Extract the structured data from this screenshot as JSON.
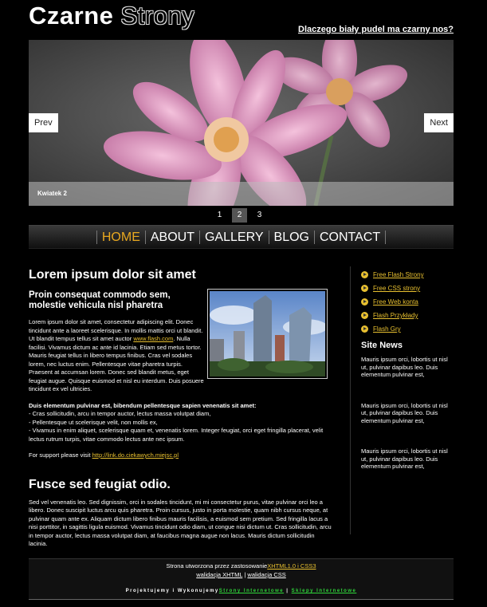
{
  "header": {
    "logo_word1": "Czarne",
    "logo_word2": "Strony",
    "tagline": "Dlaczego biały pudel ma czarny nos?"
  },
  "slider": {
    "prev_label": "Prev",
    "next_label": "Next",
    "caption": "Kwiatek 2",
    "pages": [
      "1",
      "2",
      "3"
    ],
    "active_page": "2"
  },
  "nav": {
    "items": [
      "HOME",
      "ABOUT",
      "GALLERY",
      "BLOG",
      "CONTACT"
    ],
    "active": "HOME",
    "active_color": "#e8a820"
  },
  "main": {
    "title": "Lorem ipsum dolor sit amet",
    "subtitle": "Proin consequat commodo sem, molestie vehicula nisl pharetra",
    "para1_start": "Lorem ipsum dolor sit amet, consectetur adipiscing elit. Donec tincidunt ante a laoreet scelerisque. In mollis mattis orci ut blandit. Ut blandit tempus tellus sit amet auctor ",
    "para1_link": "www.flash.com",
    "para1_end": ". Nulla facilisi. Vivamus dictum ac ante id lacinia. Etiam sed metus tortor. Mauris feugiat tellus in libero tempus finibus. Cras vel sodales lorem, nec luctus enim. Pellentesque vitae pharetra turpis. Praesent at accumsan lorem. Donec sed blandit metus, eget feugiat augue. Quisque euismod et nisl eu interdum. Duis posuere tincidunt ex vel ultricies.",
    "list_title": "Duis elementum pulvinar est, bibendum pellentesque sapien venenatis sit amet:",
    "list_items": [
      "- Cras sollicitudin, arcu in tempor auctor, lectus massa volutpat diam,",
      "- Pellentesque ut scelerisque velit, non mollis ex,",
      "- Vivamus in enim aliquet, scelerisque quam et, venenatis lorem. Integer feugiat, orci eget fringilla placerat, velit lectus rutrum turpis, vitae commodo lectus ante nec ipsum."
    ],
    "support_text": "For support please visit ",
    "support_link": "http://link.do.ciekawych.miejsc.pl",
    "title2": "Fusce sed feugiat odio.",
    "para2": "Sed vel venenatis leo. Sed dignissim, orci in sodales tincidunt, mi mi consectetur purus, vitae pulvinar orci leo a libero. Donec suscipit luctus arcu quis pharetra. Proin cursus, justo in porta molestie, quam nibh cursus neque, at pulvinar quam ante ex. Aliquam dictum libero finibus mauris facilisis, a euismod sem pretium. Sed fringilla lacus a nisi porttitor, in sagittis ligula euismod. Vivamus tincidunt odio diam, ut congue nisi dictum ut. Cras sollicitudin, arcu in tempor auctor, lectus massa volutpat diam, at faucibus magna augue non lacus. Mauris dictum sollicitudin lacinia."
  },
  "sidebar": {
    "links": [
      "Free Flash Strony",
      "Free CSS strony",
      "Free Web konta",
      "Flash Przykłady",
      "Flash Gry"
    ],
    "news_title": "Site News",
    "news": [
      "Mauris ipsum orci, lobortis ut nisl ut, pulvinar dapibus leo. Duis elementum pulvinar est,",
      "Mauris ipsum orci, lobortis ut nisl ut, pulvinar dapibus leo. Duis elementum pulvinar est,",
      "Mauris ipsum orci, lobortis ut nisl ut, pulvinar dapibus leo. Duis elementum pulvinar est,"
    ]
  },
  "footer": {
    "created_text": "Strona utworzona przez zastosowanie",
    "xhtml_css": "XHTML1.0 i CSS3",
    "valid_xhtml": "walidacja XHTML",
    "separator": "|",
    "valid_css": "walidacja CSS",
    "credit_text": "Projektujemy i Wykonujemy",
    "credit_link1": "Strony Internetowe",
    "credit_sep": "|",
    "credit_link2": "Sklepy Internetowe"
  },
  "colors": {
    "background": "#000000",
    "link": "#e8c030",
    "credit_link": "#2fd63a"
  }
}
